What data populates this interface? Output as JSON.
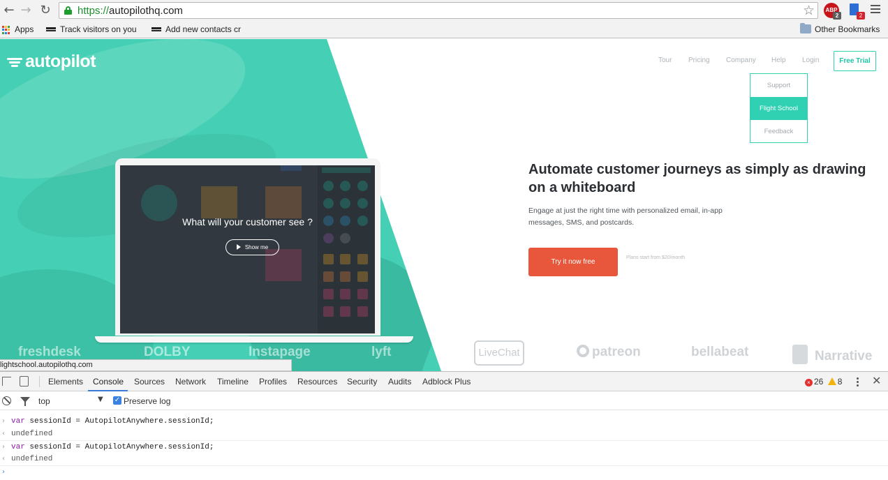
{
  "browser": {
    "url_protocol": "https://",
    "url_host": "autopilothq.com",
    "ext_abp_label": "ABP",
    "ext_abp_badge": "2",
    "ext_doc_badge": "2",
    "bookmarks": [
      {
        "label": "Apps"
      },
      {
        "label": "Track visitors on you"
      },
      {
        "label": "Add new contacts cr"
      }
    ],
    "other_bookmarks": "Other Bookmarks"
  },
  "site": {
    "logo": "autopilot",
    "nav": [
      "Tour",
      "Pricing",
      "Company",
      "Help",
      "Login"
    ],
    "free_trial": "Free Trial",
    "company_dropdown": [
      "Support",
      "Flight School",
      "Feedback"
    ],
    "headline": "Automate customer journeys as simply as drawing on a whiteboard",
    "subtext": "Engage at just the right time with personalized email, in-app messages, SMS, and postcards.",
    "cta": "Try it now free",
    "cta_note": "Plans start from $20/month",
    "video_question": "What will your customer see ?",
    "show_me": "Show me",
    "brands": [
      "freshdesk",
      "DOLBY",
      "Instapage",
      "lyft",
      "LiveChat",
      "patreon",
      "bellabeat",
      "Narrative"
    ],
    "accent": "#2fd1b2",
    "cta_color": "#e8573b"
  },
  "status_bar": "lightschool.autopilothq.com",
  "devtools": {
    "tabs": [
      "Elements",
      "Console",
      "Sources",
      "Network",
      "Timeline",
      "Profiles",
      "Resources",
      "Security",
      "Audits",
      "Adblock Plus"
    ],
    "active_tab": "Console",
    "error_count": "26",
    "warning_count": "8",
    "context": "top",
    "preserve_log": "Preserve log",
    "console": [
      {
        "type": "input",
        "keyword": "var",
        "code": " sessionId = AutopilotAnywhere.sessionId;"
      },
      {
        "type": "output",
        "code": "undefined"
      },
      {
        "type": "input",
        "keyword": "var",
        "code": " sessionId = AutopilotAnywhere.sessionId;"
      },
      {
        "type": "output",
        "code": "undefined"
      }
    ]
  }
}
